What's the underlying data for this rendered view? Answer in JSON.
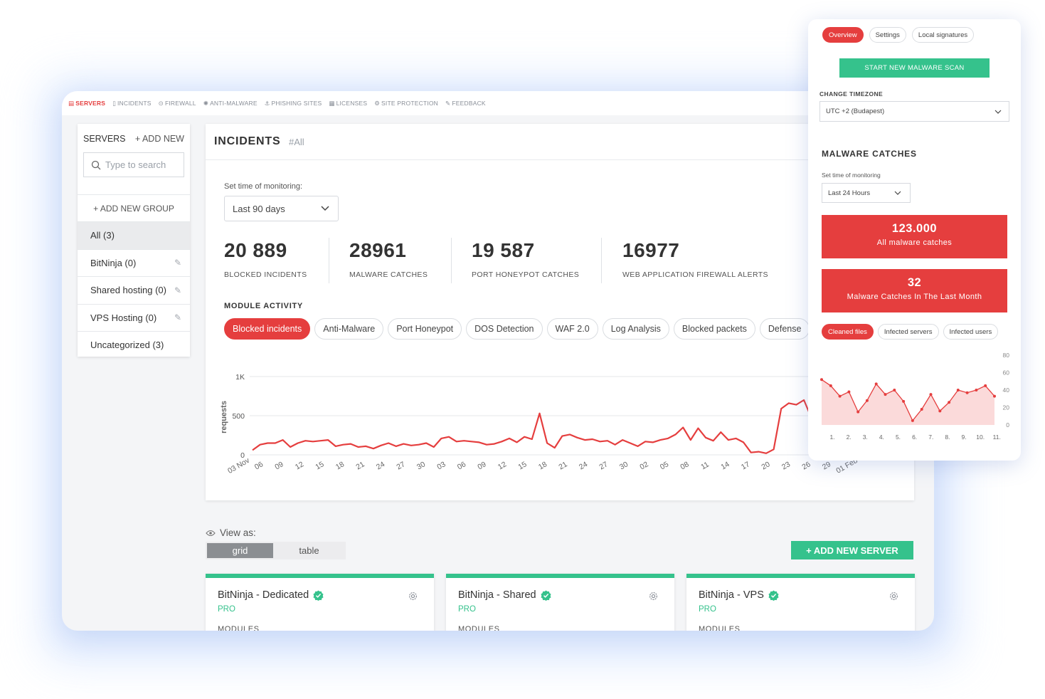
{
  "topnav": [
    {
      "label": "SERVERS",
      "icon": "server-icon",
      "active": true
    },
    {
      "label": "INCIDENTS",
      "icon": "document-icon",
      "active": false
    },
    {
      "label": "FIREWALL",
      "icon": "lock-icon",
      "active": false
    },
    {
      "label": "ANTI-MALWARE",
      "icon": "bug-icon",
      "active": false
    },
    {
      "label": "PHISHING SITES",
      "icon": "hook-icon",
      "active": false
    },
    {
      "label": "LICENSES",
      "icon": "grid-icon",
      "active": false
    },
    {
      "label": "SITE PROTECTION",
      "icon": "gear-icon",
      "active": false
    },
    {
      "label": "FEEDBACK",
      "icon": "chat-icon",
      "active": false
    }
  ],
  "sidebar": {
    "title": "SERVERS",
    "add_label": "+ ADD NEW",
    "search_placeholder": "Type to search",
    "add_group": "+ ADD NEW GROUP",
    "groups": [
      {
        "label": "All (3)",
        "selected": true,
        "editable": false
      },
      {
        "label": "BitNinja (0)",
        "selected": false,
        "editable": true
      },
      {
        "label": "Shared hosting (0)",
        "selected": false,
        "editable": true
      },
      {
        "label": "VPS Hosting (0)",
        "selected": false,
        "editable": true
      },
      {
        "label": "Uncategorized (3)",
        "selected": false,
        "editable": false
      }
    ]
  },
  "incidents": {
    "title": "INCIDENTS",
    "tag": "#All",
    "monitor_label": "Set time of monitoring:",
    "monitor_value": "Last 90 days",
    "stats": [
      {
        "value": "20 889",
        "label": "BLOCKED INCIDENTS"
      },
      {
        "value": "28961",
        "label": "MALWARE CATCHES"
      },
      {
        "value": "19 587",
        "label": "PORT HONEYPOT CATCHES"
      },
      {
        "value": "16977",
        "label": "WEB APPLICATION FIREWALL ALERTS"
      }
    ],
    "module_title": "MODULE ACTIVITY",
    "modules": [
      {
        "label": "Blocked incidents",
        "active": true
      },
      {
        "label": "Anti-Malware",
        "active": false
      },
      {
        "label": "Port Honeypot",
        "active": false
      },
      {
        "label": "DOS Detection",
        "active": false
      },
      {
        "label": "WAF 2.0",
        "active": false
      },
      {
        "label": "Log Analysis",
        "active": false
      },
      {
        "label": "Blocked packets",
        "active": false
      },
      {
        "label": "Defense",
        "active": false
      }
    ]
  },
  "chart_data": [
    {
      "type": "line",
      "ylabel": "requests",
      "ylim": [
        0,
        1000
      ],
      "yticks": [
        "0",
        "500",
        "1K"
      ],
      "color": "#e53e3e",
      "xticks": [
        "03 Nov",
        "06",
        "09",
        "12",
        "15",
        "18",
        "21",
        "24",
        "27",
        "30",
        "03",
        "06",
        "09",
        "12",
        "15",
        "18",
        "21",
        "24",
        "27",
        "30",
        "02",
        "05",
        "08",
        "11",
        "14",
        "17",
        "20",
        "23",
        "26",
        "29",
        "01 Feb"
      ],
      "values": [
        60,
        130,
        150,
        150,
        190,
        100,
        150,
        180,
        170,
        180,
        190,
        110,
        130,
        140,
        100,
        110,
        80,
        120,
        150,
        110,
        140,
        120,
        130,
        150,
        100,
        210,
        230,
        170,
        180,
        170,
        160,
        130,
        140,
        170,
        210,
        160,
        230,
        200,
        530,
        150,
        90,
        240,
        260,
        220,
        190,
        200,
        170,
        180,
        130,
        190,
        150,
        110,
        170,
        160,
        190,
        210,
        260,
        350,
        190,
        340,
        220,
        180,
        290,
        190,
        210,
        160,
        30,
        40,
        20,
        70,
        590,
        660,
        640,
        700,
        470,
        400,
        430,
        420,
        400,
        420,
        410,
        420
      ]
    },
    {
      "type": "area",
      "xticks": [
        "1.",
        "2.",
        "3.",
        "4.",
        "5.",
        "6.",
        "7.",
        "8.",
        "9.",
        "10.",
        "11."
      ],
      "ylim": [
        0,
        80
      ],
      "yticks": [
        "0",
        "20",
        "40",
        "60",
        "80"
      ],
      "color": "#e53e3e",
      "values": [
        52,
        45,
        33,
        38,
        15,
        28,
        47,
        35,
        40,
        27,
        5,
        18,
        35,
        16,
        26,
        40,
        37,
        40,
        45,
        33
      ]
    }
  ],
  "view": {
    "label": "View as:",
    "options": [
      {
        "label": "grid",
        "active": true
      },
      {
        "label": "table",
        "active": false
      }
    ],
    "add_server": "+ ADD NEW SERVER"
  },
  "servers": [
    {
      "name": "BitNinja - Dedicated",
      "tier": "PRO",
      "modules_label": "MODULES"
    },
    {
      "name": "BitNinja - Shared",
      "tier": "PRO",
      "modules_label": "MODULES"
    },
    {
      "name": "BitNinja - VPS",
      "tier": "PRO",
      "modules_label": "MODULES"
    }
  ],
  "panel": {
    "tabs": [
      {
        "label": "Overview",
        "active": true
      },
      {
        "label": "Settings",
        "active": false
      },
      {
        "label": "Local signatures",
        "active": false
      }
    ],
    "scan_button": "START NEW MALWARE SCAN",
    "tz_label": "CHANGE TIMEZONE",
    "tz_value": "UTC +2 (Budapest)",
    "mc_title": "MALWARE CATCHES",
    "mc_monitor_label": "Set time of monitoring",
    "mc_monitor_value": "Last 24 Hours",
    "boxes": [
      {
        "value": "123.000",
        "label": "All malware catches"
      },
      {
        "value": "32",
        "label": "Malware Catches In The Last Month"
      }
    ],
    "chart_tabs": [
      {
        "label": "Cleaned files",
        "active": true
      },
      {
        "label": "Infected servers",
        "active": false
      },
      {
        "label": "Infected users",
        "active": false
      }
    ]
  },
  "colors": {
    "accent_red": "#e53e3e",
    "accent_green": "#35c28c"
  }
}
